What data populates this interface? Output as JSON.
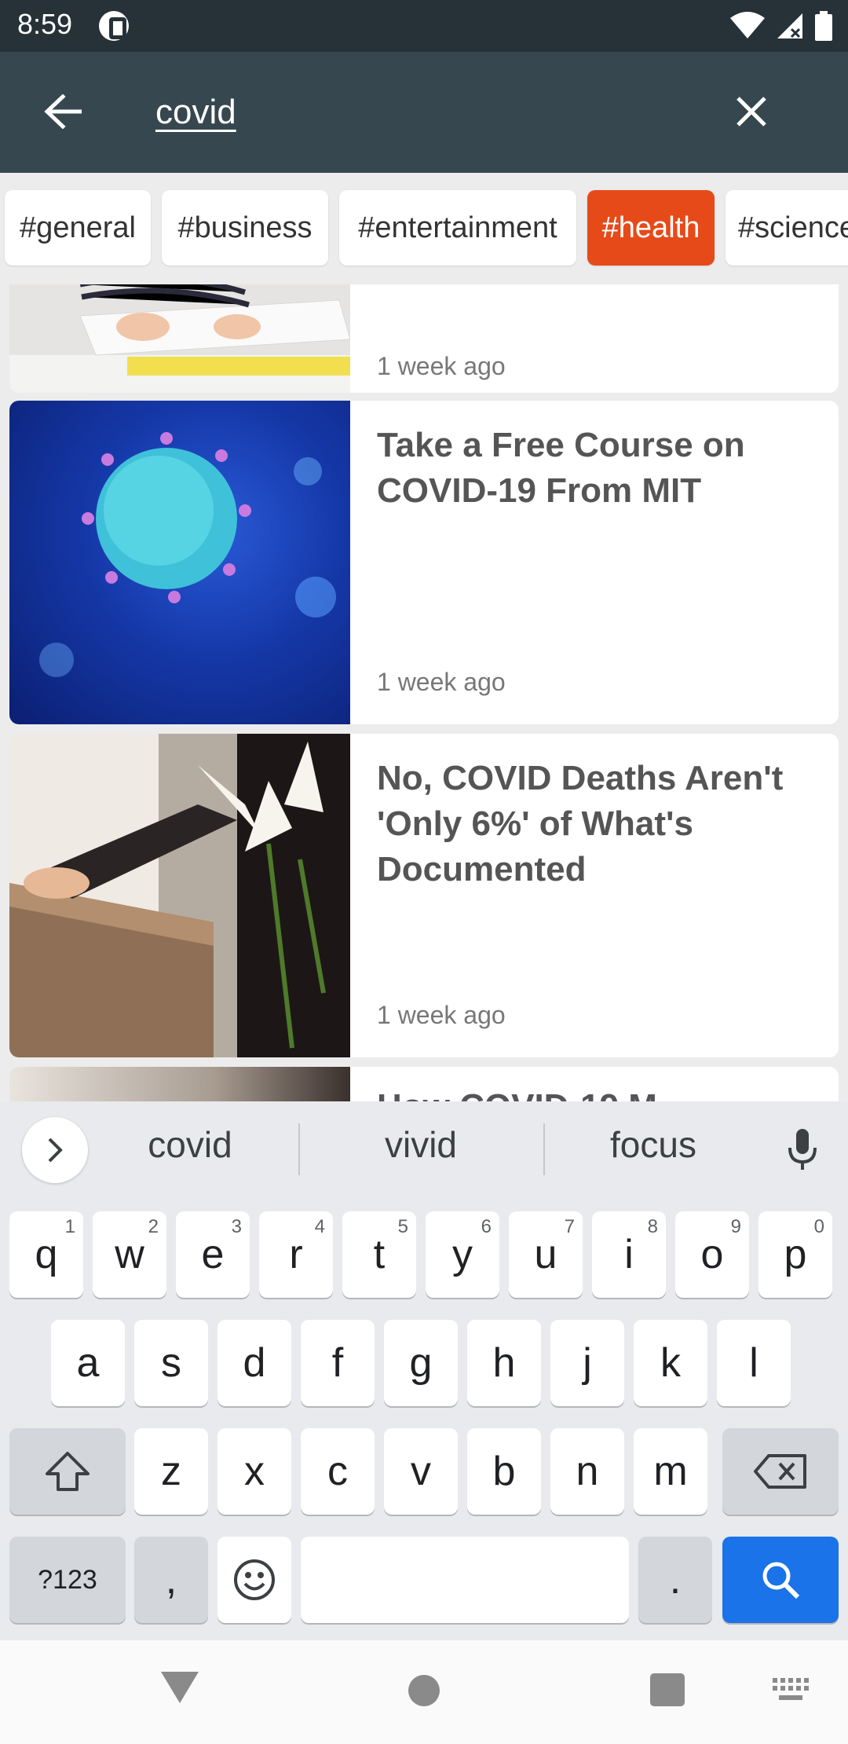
{
  "status_bar": {
    "time": "8:59"
  },
  "search": {
    "query": "covid"
  },
  "categories": [
    {
      "label": "#general",
      "active": false
    },
    {
      "label": "#business",
      "active": false
    },
    {
      "label": "#entertainment",
      "active": false
    },
    {
      "label": "#health",
      "active": true
    },
    {
      "label": "#science",
      "active": false
    }
  ],
  "articles": [
    {
      "title": "",
      "time": "1 week ago"
    },
    {
      "title": "Take a Free Course on COVID-19 From MIT",
      "time": "1 week ago"
    },
    {
      "title": "No, COVID Deaths Aren't 'Only 6%' of What's Documented",
      "time": "1 week ago"
    },
    {
      "title": "How COVID-19 M",
      "time": ""
    }
  ],
  "keyboard": {
    "suggestions": [
      "covid",
      "vivid",
      "focus"
    ],
    "row1": [
      {
        "key": "q",
        "hint": "1"
      },
      {
        "key": "w",
        "hint": "2"
      },
      {
        "key": "e",
        "hint": "3"
      },
      {
        "key": "r",
        "hint": "4"
      },
      {
        "key": "t",
        "hint": "5"
      },
      {
        "key": "y",
        "hint": "6"
      },
      {
        "key": "u",
        "hint": "7"
      },
      {
        "key": "i",
        "hint": "8"
      },
      {
        "key": "o",
        "hint": "9"
      },
      {
        "key": "p",
        "hint": "0"
      }
    ],
    "row2": [
      "a",
      "s",
      "d",
      "f",
      "g",
      "h",
      "j",
      "k",
      "l"
    ],
    "row3": [
      "z",
      "x",
      "c",
      "v",
      "b",
      "n",
      "m"
    ],
    "symbols_label": "?123",
    "comma": ",",
    "period": "."
  },
  "colors": {
    "status_bar": "#263238",
    "toolbar": "#37474f",
    "active_chip": "#e64a19",
    "search_key": "#1a73e8"
  }
}
